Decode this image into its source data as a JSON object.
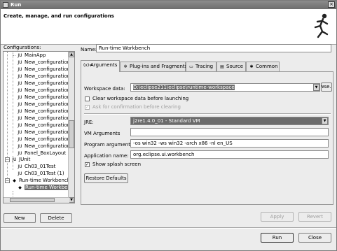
{
  "window": {
    "title": "Run",
    "close_glyph": "×"
  },
  "banner": {
    "title": "Create, manage, and run configurations",
    "icon": "running-figure-icon"
  },
  "configurations": {
    "label": "Configurations:",
    "items": [
      {
        "label": "MainApp",
        "icon": "JU"
      },
      {
        "label": "New_configuration",
        "icon": "JU"
      },
      {
        "label": "New_configuration",
        "icon": "JU"
      },
      {
        "label": "New_configuration",
        "icon": "JU"
      },
      {
        "label": "New_configuration",
        "icon": "JU"
      },
      {
        "label": "New_configuration",
        "icon": "JU"
      },
      {
        "label": "New_configuration",
        "icon": "JU"
      },
      {
        "label": "New_configuration",
        "icon": "JU"
      },
      {
        "label": "New_configuration",
        "icon": "JU"
      },
      {
        "label": "New_configuration",
        "icon": "JU"
      },
      {
        "label": "New_configuration",
        "icon": "JU"
      },
      {
        "label": "New_configuration",
        "icon": "JU"
      },
      {
        "label": "New_configuration",
        "icon": "JU"
      },
      {
        "label": "New_configuration",
        "icon": "JU"
      },
      {
        "label": "Panel_BoxLayout",
        "icon": "JU"
      },
      {
        "label": "JUnit",
        "icon": "JU"
      },
      {
        "label": "Ch03_01Test",
        "icon": "JU"
      },
      {
        "label": "Ch03_01Test (1)",
        "icon": "JU"
      },
      {
        "label": "Run-time Workbench",
        "icon": "◆"
      },
      {
        "label": "Run-time Workbe",
        "icon": "◆"
      }
    ],
    "expand_glyphs": {
      "junit": "−",
      "workbench": "−"
    },
    "scroll_up": "▲",
    "scroll_down": "▼"
  },
  "left_buttons": {
    "new": "New",
    "delete": "Delete"
  },
  "name_field": {
    "label": "Name:",
    "value": "Run-time Workbench"
  },
  "tabs": [
    {
      "label": "Arguments",
      "icon": "(x)="
    },
    {
      "label": "Plug-ins and Fragments",
      "icon": "✲"
    },
    {
      "label": "Tracing",
      "icon": "▭"
    },
    {
      "label": "Source",
      "icon": "▤"
    },
    {
      "label": "Common",
      "icon": "✱"
    }
  ],
  "arguments": {
    "workspace_label": "Workspace data:",
    "workspace_value": "D:\\eclipse211\\eclipse\\runtime-workspace",
    "browse_label": "Browse...",
    "clear_workspace_label": "Clear workspace data before launching",
    "ask_confirm_label": "Ask for confirmation before clearing",
    "jre_label": "JRE:",
    "jre_value": "j2re1.4.0_01 - Standard VM",
    "vm_args_label": "VM Arguments",
    "vm_args_value": "",
    "program_args_label": "Program arguments:",
    "program_args_value": "-os win32 -ws win32 -arch x86 -nl en_US",
    "app_name_label": "Application name:",
    "app_name_value": "org.eclipse.ui.workbench",
    "splash_label": "Show splash screen",
    "restore_label": "Restore Defaults",
    "dropdown_glyph": "▼",
    "checkmark": "✓"
  },
  "action_buttons": {
    "apply": "Apply",
    "revert": "Revert",
    "run": "Run",
    "close": "Close"
  }
}
